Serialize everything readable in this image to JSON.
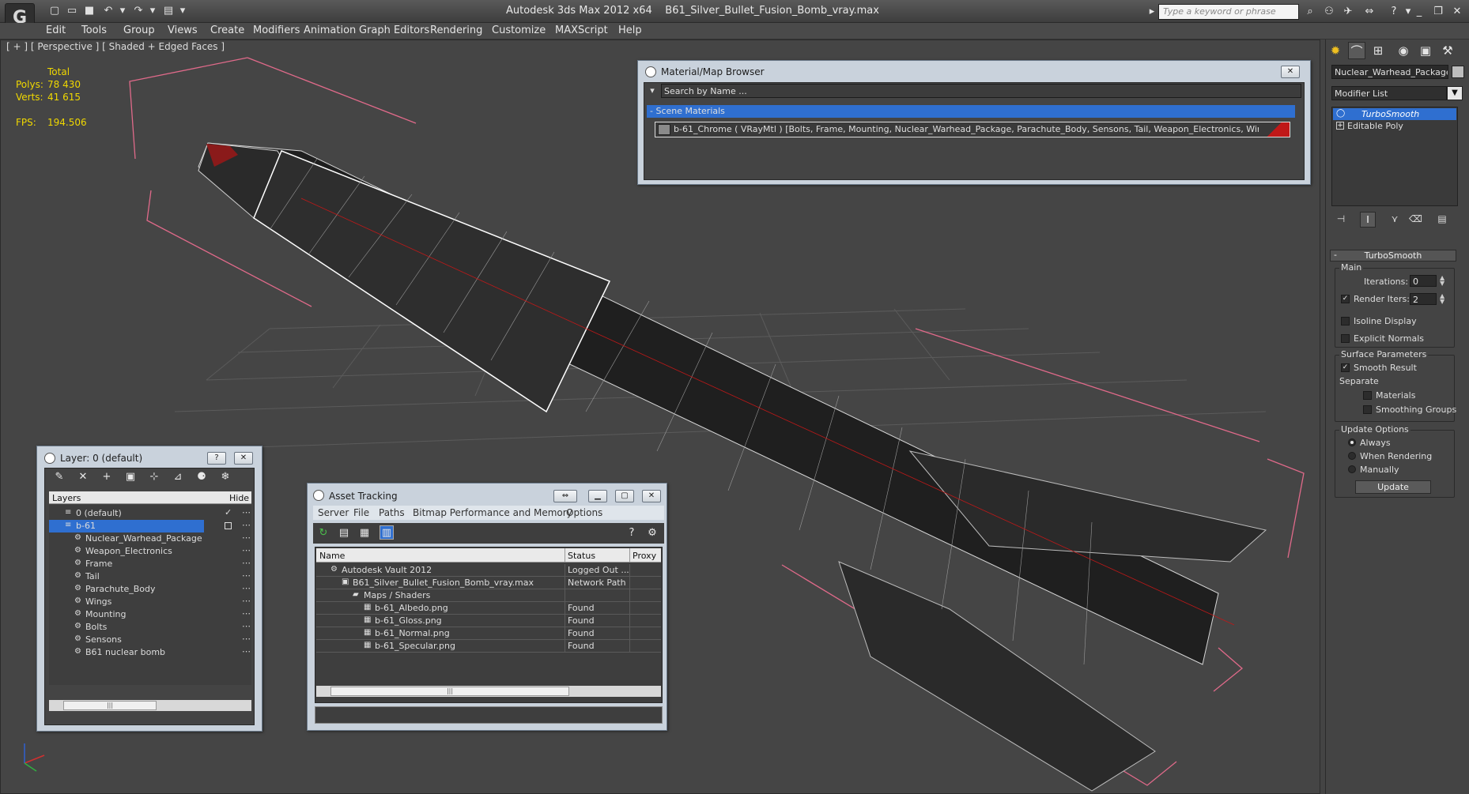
{
  "titlebar": {
    "app_title": "Autodesk 3ds Max  2012 x64",
    "file_title": "B61_Silver_Bullet_Fusion_Bomb_vray.max",
    "search_placeholder": "Type a keyword or phrase",
    "logo_glyph": "G"
  },
  "menu": [
    "Edit",
    "Tools",
    "Group",
    "Views",
    "Create",
    "Modifiers",
    "Animation",
    "Graph Editors",
    "Rendering",
    "Customize",
    "MAXScript",
    "Help"
  ],
  "viewport": {
    "label": "[ + ] [ Perspective ] [ Shaded + Edged Faces ]",
    "stats": {
      "total_label": "Total",
      "polys_label": "Polys:",
      "polys_value": "78 430",
      "verts_label": "Verts:",
      "verts_value": "41 615",
      "fps_label": "FPS:",
      "fps_value": "194.506"
    }
  },
  "material_browser": {
    "title": "Material/Map Browser",
    "search_placeholder": "Search by Name ...",
    "section": "- Scene Materials",
    "material": "b-61_Chrome  ( VRayMtl )  [Bolts, Frame, Mounting, Nuclear_Warhead_Package, Parachute_Body, Sensons, Tail, Weapon_Electronics, Wings]"
  },
  "command_panel": {
    "object_name": "Nuclear_Warhead_Package",
    "modifier_list": "Modifier List",
    "stack": [
      "TurboSmooth",
      "Editable Poly"
    ],
    "rollout_title": "TurboSmooth",
    "main_label": "Main",
    "iterations_label": "Iterations:",
    "iterations_value": "0",
    "render_iters_label": "Render Iters:",
    "render_iters_value": "2",
    "isoline_label": "Isoline Display",
    "explicit_normals_label": "Explicit Normals",
    "surface_params_label": "Surface Parameters",
    "smooth_result_label": "Smooth Result",
    "separate_label": "Separate",
    "materials_label": "Materials",
    "smoothing_groups_label": "Smoothing Groups",
    "update_options_label": "Update Options",
    "always_label": "Always",
    "when_rendering_label": "When Rendering",
    "manually_label": "Manually",
    "update_button": "Update",
    "render_iters_checked": true,
    "smooth_result_checked": true,
    "update_mode": "Always"
  },
  "layer_window": {
    "title": "Layer: 0 (default)",
    "col_layers": "Layers",
    "col_hide": "Hide",
    "rows": [
      {
        "label": "0 (default)",
        "level": 0,
        "checked": true
      },
      {
        "label": "b-61",
        "level": 0,
        "selected": true
      },
      {
        "label": "Nuclear_Warhead_Package",
        "level": 1
      },
      {
        "label": "Weapon_Electronics",
        "level": 1
      },
      {
        "label": "Frame",
        "level": 1
      },
      {
        "label": "Tail",
        "level": 1
      },
      {
        "label": "Parachute_Body",
        "level": 1
      },
      {
        "label": "Wings",
        "level": 1
      },
      {
        "label": "Mounting",
        "level": 1
      },
      {
        "label": "Bolts",
        "level": 1
      },
      {
        "label": "Sensons",
        "level": 1
      },
      {
        "label": "B61 nuclear bomb",
        "level": 1
      }
    ]
  },
  "asset_tracking": {
    "title": "Asset Tracking",
    "menu": [
      "Server",
      "File",
      "Paths",
      "Bitmap Performance and Memory",
      "Options"
    ],
    "columns": [
      "Name",
      "Status",
      "Proxy"
    ],
    "rows": [
      {
        "name": "Autodesk Vault 2012",
        "status": "Logged Out ...",
        "indent": 1
      },
      {
        "name": "B61_Silver_Bullet_Fusion_Bomb_vray.max",
        "status": "Network Path",
        "indent": 2
      },
      {
        "name": "Maps / Shaders",
        "status": "",
        "indent": 3
      },
      {
        "name": "b-61_Albedo.png",
        "status": "Found",
        "indent": 4
      },
      {
        "name": "b-61_Gloss.png",
        "status": "Found",
        "indent": 4
      },
      {
        "name": "b-61_Normal.png",
        "status": "Found",
        "indent": 4
      },
      {
        "name": "b-61_Specular.png",
        "status": "Found",
        "indent": 4
      }
    ]
  },
  "colors": {
    "accent_blue": "#2f6fd0",
    "stat_yellow": "#f0d800",
    "bbox_pink": "#e06a8a",
    "chrome_red": "#c01818"
  }
}
